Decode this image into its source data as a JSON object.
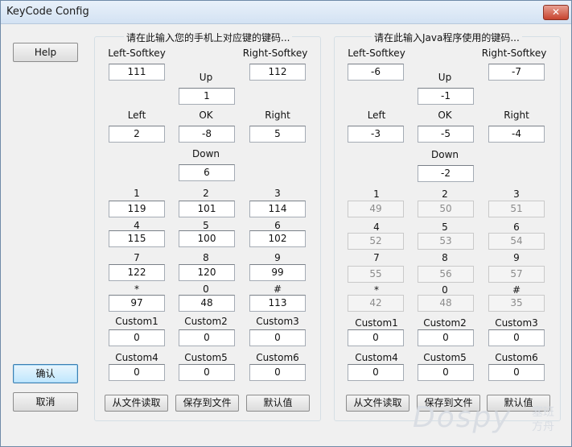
{
  "window": {
    "title": "KeyCode Config",
    "close_glyph": "✕"
  },
  "buttons": {
    "help": "Help",
    "confirm": "确认",
    "cancel": "取消"
  },
  "left_panel": {
    "title": "请在此输入您的手机上对应键的键码...",
    "left_softkey": {
      "label": "Left-Softkey",
      "value": "111"
    },
    "right_softkey": {
      "label": "Right-Softkey",
      "value": "112"
    },
    "up": {
      "label": "Up",
      "value": "1"
    },
    "left": {
      "label": "Left",
      "value": "2"
    },
    "ok": {
      "label": "OK",
      "value": "-8"
    },
    "right": {
      "label": "Right",
      "value": "5"
    },
    "down": {
      "label": "Down",
      "value": "6"
    },
    "k1": {
      "label": "1",
      "value": "119"
    },
    "k2": {
      "label": "2",
      "value": "101"
    },
    "k3": {
      "label": "3",
      "value": "114"
    },
    "k4": {
      "label": "4",
      "value": "115"
    },
    "k5": {
      "label": "5",
      "value": "100"
    },
    "k6": {
      "label": "6",
      "value": "102"
    },
    "k7": {
      "label": "7",
      "value": "122"
    },
    "k8": {
      "label": "8",
      "value": "120"
    },
    "k9": {
      "label": "9",
      "value": "99"
    },
    "kstar": {
      "label": "*",
      "value": "97"
    },
    "k0": {
      "label": "0",
      "value": "48"
    },
    "khash": {
      "label": "#",
      "value": "113"
    },
    "custom1": {
      "label": "Custom1",
      "value": "0"
    },
    "custom2": {
      "label": "Custom2",
      "value": "0"
    },
    "custom3": {
      "label": "Custom3",
      "value": "0"
    },
    "custom4": {
      "label": "Custom4",
      "value": "0"
    },
    "custom5": {
      "label": "Custom5",
      "value": "0"
    },
    "custom6": {
      "label": "Custom6",
      "value": "0"
    },
    "load_button": "从文件读取",
    "save_button": "保存到文件",
    "default_button": "默认值"
  },
  "right_panel": {
    "title": "请在此输入Java程序使用的键码...",
    "left_softkey": {
      "label": "Left-Softkey",
      "value": "-6"
    },
    "right_softkey": {
      "label": "Right-Softkey",
      "value": "-7"
    },
    "up": {
      "label": "Up",
      "value": "-1"
    },
    "left": {
      "label": "Left",
      "value": "-3"
    },
    "ok": {
      "label": "OK",
      "value": "-5"
    },
    "right": {
      "label": "Right",
      "value": "-4"
    },
    "down": {
      "label": "Down",
      "value": "-2"
    },
    "k1": {
      "label": "1",
      "value": "49"
    },
    "k2": {
      "label": "2",
      "value": "50"
    },
    "k3": {
      "label": "3",
      "value": "51"
    },
    "k4": {
      "label": "4",
      "value": "52"
    },
    "k5": {
      "label": "5",
      "value": "53"
    },
    "k6": {
      "label": "6",
      "value": "54"
    },
    "k7": {
      "label": "7",
      "value": "55"
    },
    "k8": {
      "label": "8",
      "value": "56"
    },
    "k9": {
      "label": "9",
      "value": "57"
    },
    "kstar": {
      "label": "*",
      "value": "42"
    },
    "k0": {
      "label": "0",
      "value": "48"
    },
    "khash": {
      "label": "#",
      "value": "35"
    },
    "custom1": {
      "label": "Custom1",
      "value": "0"
    },
    "custom2": {
      "label": "Custom2",
      "value": "0"
    },
    "custom3": {
      "label": "Custom3",
      "value": "0"
    },
    "custom4": {
      "label": "Custom4",
      "value": "0"
    },
    "custom5": {
      "label": "Custom5",
      "value": "0"
    },
    "custom6": {
      "label": "Custom6",
      "value": "0"
    },
    "load_button": "从文件读取",
    "save_button": "保存到文件",
    "default_button": "默认值"
  },
  "watermark": {
    "brand": "Dospy",
    "line1": "塞班",
    "line2": "方舟"
  }
}
